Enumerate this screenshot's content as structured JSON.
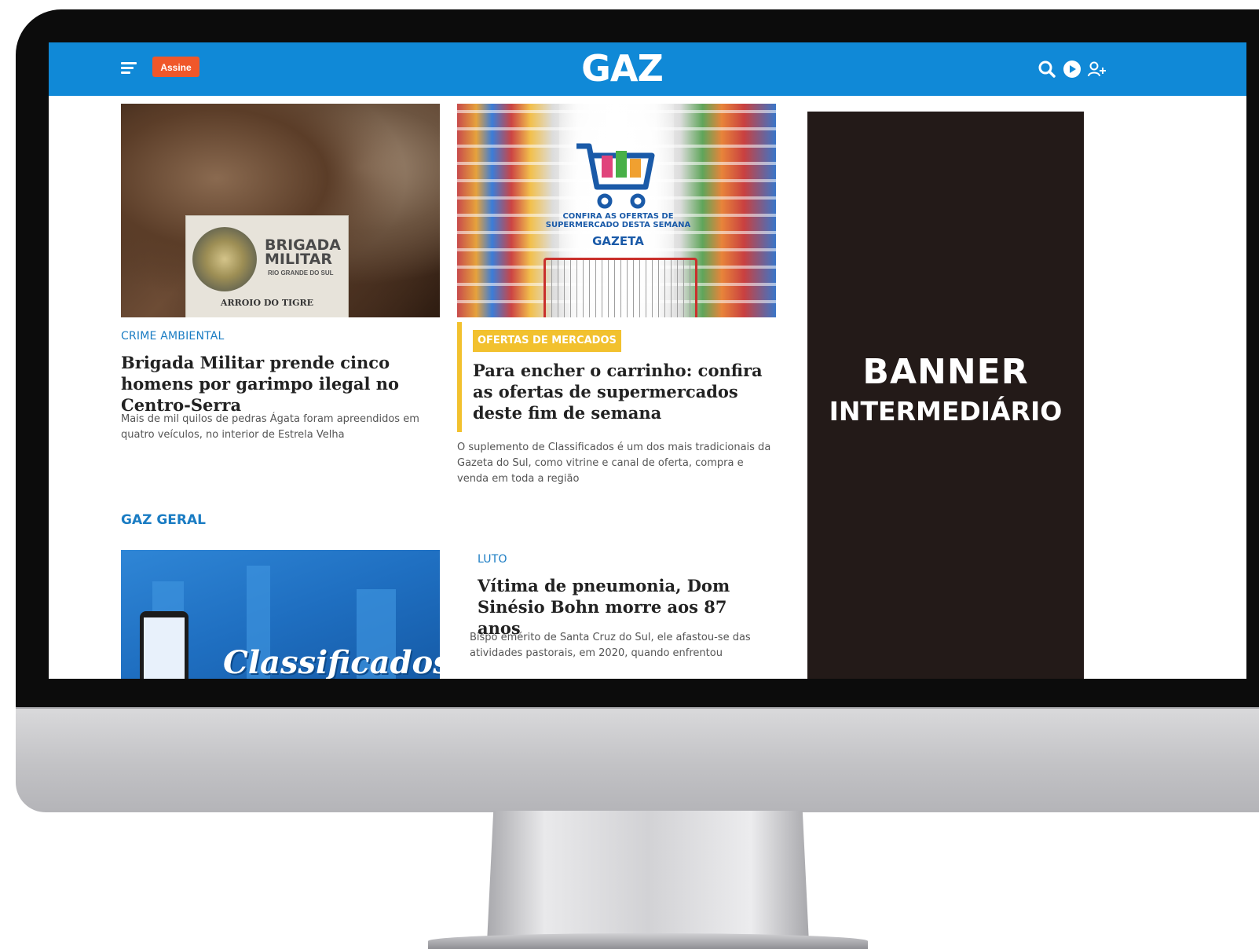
{
  "header": {
    "subscribe_label": "Assine",
    "logo_text": "GAZ",
    "colors": {
      "bar": "#1089d7",
      "subscribe": "#f0572a"
    },
    "icons": [
      "menu-icon",
      "search-icon",
      "play-icon",
      "add-user-icon"
    ]
  },
  "articles": [
    {
      "image": {
        "sign_title": "BRIGADA\nMILITAR",
        "sign_sub": "RIO GRANDE DO SUL",
        "sign_place": "ARROIO DO TIGRE"
      },
      "kicker": "CRIME AMBIENTAL",
      "headline": "Brigada Militar prende cinco homens por garimpo ilegal no Centro-Serra",
      "summary": "Mais de mil quilos de pedras Ágata foram apreendidos em quatro veículos, no interior de Estrela Velha"
    },
    {
      "image": {
        "promo_line1": "CONFIRA AS OFERTAS DE SUPERMERCADO DESTA SEMANA",
        "promo_brand": "GAZETA"
      },
      "kicker": "OFERTAS DE MERCADOS",
      "headline": "Para encher o carrinho: confira as ofertas de supermercados deste fim de semana",
      "summary": "O suplemento de Classificados é um dos mais tradicionais da Gazeta do Sul, como vitrine e canal de oferta, compra e venda em toda a região"
    }
  ],
  "section": {
    "title": "GAZ GERAL",
    "image_text": "Classificados",
    "article": {
      "kicker": "LUTO",
      "headline": "Vítima de pneumonia, Dom Sinésio Bohn morre aos 87 anos",
      "summary": "Bispo emérito de Santa Cruz do Sul, ele afastou-se das atividades pastorais, em 2020, quando enfrentou"
    }
  },
  "banner": {
    "line1": "BANNER",
    "line2": "INTERMEDIÁRIO",
    "color": "#231a18"
  }
}
